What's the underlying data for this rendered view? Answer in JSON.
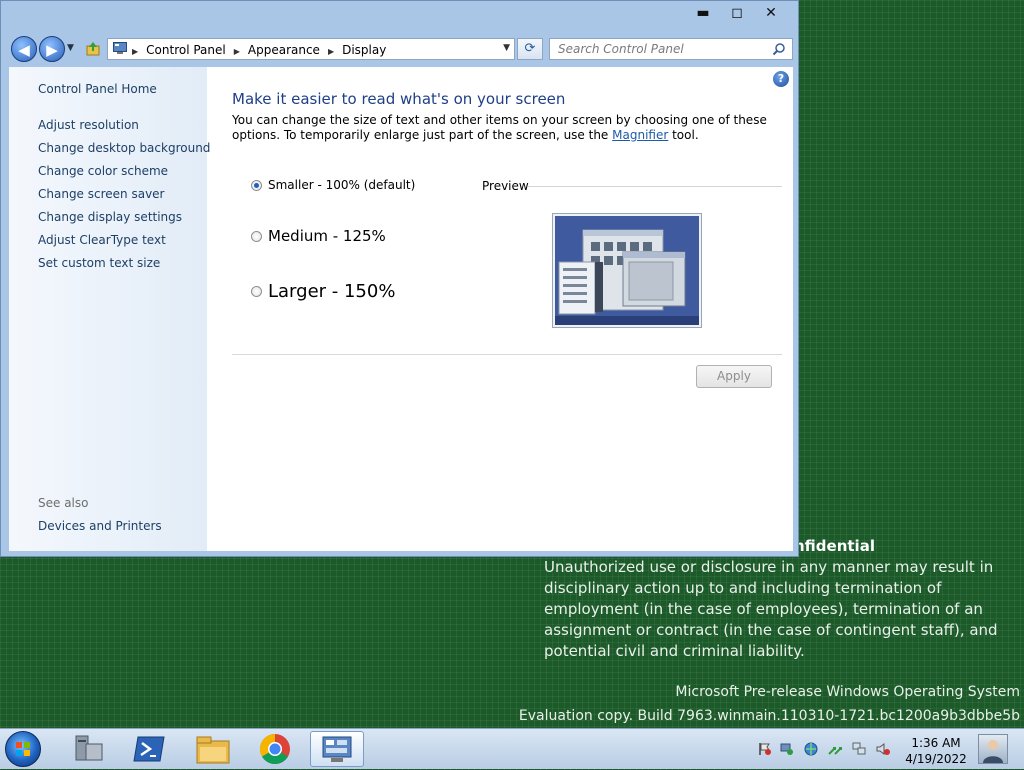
{
  "desktop": {
    "notice_title": "nfidential",
    "notice_body": "Unauthorized use or disclosure in any manner may result in disciplinary action up to and including termination of employment (in the case of employees), termination of an assignment or contract (in the case of contingent staff), and potential civil and criminal liability.",
    "eval_line1": "Microsoft Pre-release Windows Operating System",
    "eval_line2": "Evaluation copy. Build 7963.winmain.110310-1721.bc1200a9b3dbbe5b"
  },
  "window": {
    "controls": {
      "minimize": "▬",
      "maximize": "◻",
      "close": "✕"
    },
    "nav": {
      "back": "◀",
      "forward": "▶"
    },
    "breadcrumb": [
      "Control Panel",
      "Appearance",
      "Display"
    ],
    "search_placeholder": "Search Control Panel",
    "refresh": "⟳"
  },
  "sidebar": {
    "home": "Control Panel Home",
    "links": [
      "Adjust resolution",
      "Change desktop background",
      "Change color scheme",
      "Change screen saver",
      "Change display settings",
      "Adjust ClearType text",
      "Set custom text size"
    ],
    "see_also": "See also",
    "devices": "Devices and Printers"
  },
  "main": {
    "heading": "Make it easier to read what's on your screen",
    "desc_before": "You can change the size of text and other items on your screen by choosing one of these options. To temporarily enlarge just part of the screen, use the ",
    "desc_link": "Magnifier",
    "desc_after": " tool.",
    "help": "?",
    "options": [
      {
        "label": "Smaller - 100% (default)",
        "selected": true
      },
      {
        "label": "Medium - 125%",
        "selected": false
      },
      {
        "label": "Larger - 150%",
        "selected": false
      }
    ],
    "preview_label": "Preview",
    "apply": "Apply"
  },
  "taskbar": {
    "time": "1:36 AM",
    "date": "4/19/2022",
    "pinned": [
      "server-manager-icon",
      "powershell-icon",
      "file-explorer-icon",
      "chrome-icon",
      "control-panel-icon"
    ],
    "active": "control-panel-icon"
  },
  "colors": {
    "desktop_green": "#1c5a2a",
    "link_blue": "#1e3f66",
    "heading_blue": "#1f3f87"
  }
}
